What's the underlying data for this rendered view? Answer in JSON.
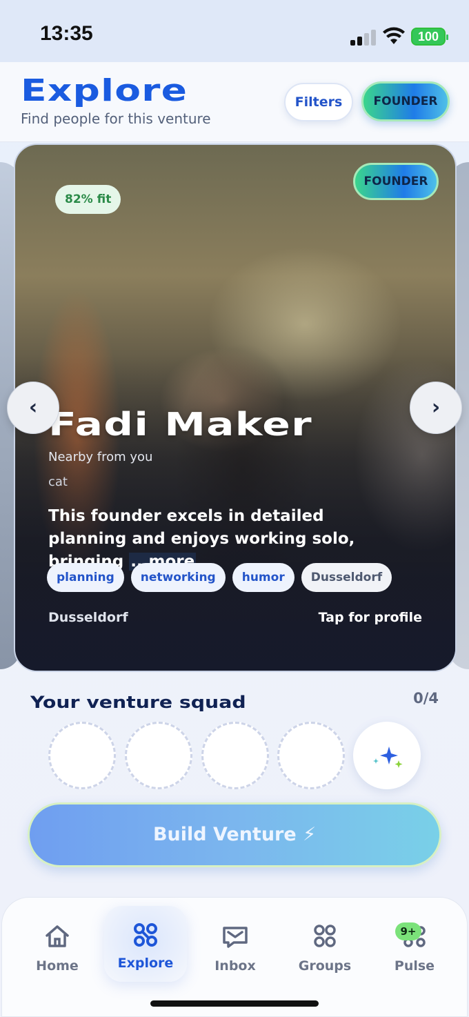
{
  "status_bar": {
    "time": "13:35",
    "battery": "100"
  },
  "header": {
    "title": "Explore",
    "subtitle": "Find people for this venture",
    "filters_label": "Filters",
    "role_filter_label": "FOUNDER"
  },
  "card": {
    "fit": "82% fit",
    "role": "FOUNDER",
    "name": "Fadi Maker",
    "nearby": "Nearby from you",
    "alias": "cat",
    "bio": "This founder excels in detailed planning and enjoys working solo, bringing ",
    "bio_more": "...more",
    "tags": [
      "planning",
      "networking",
      "humor",
      "Dusseldorf"
    ],
    "location": "Dusseldorf",
    "tap_label": "Tap for profile",
    "prev_label": "‹",
    "next_label": "›"
  },
  "squad": {
    "title": "Your venture squad",
    "count": "0/4"
  },
  "build_button": "Build Venture ⚡",
  "nav": {
    "items": [
      {
        "label": "Home",
        "icon": "home-icon"
      },
      {
        "label": "Explore",
        "icon": "explore-icon"
      },
      {
        "label": "Inbox",
        "icon": "inbox-icon"
      },
      {
        "label": "Groups",
        "icon": "groups-icon"
      },
      {
        "label": "Pulse",
        "icon": "pulse-icon"
      }
    ],
    "active": "Explore",
    "pulse_badge": "9+"
  },
  "colors": {
    "accent": "#1a5be0",
    "founder_gradient_start": "#3bd58c",
    "founder_gradient_end": "#1f7ce8",
    "fit_green": "#2a8a48"
  }
}
